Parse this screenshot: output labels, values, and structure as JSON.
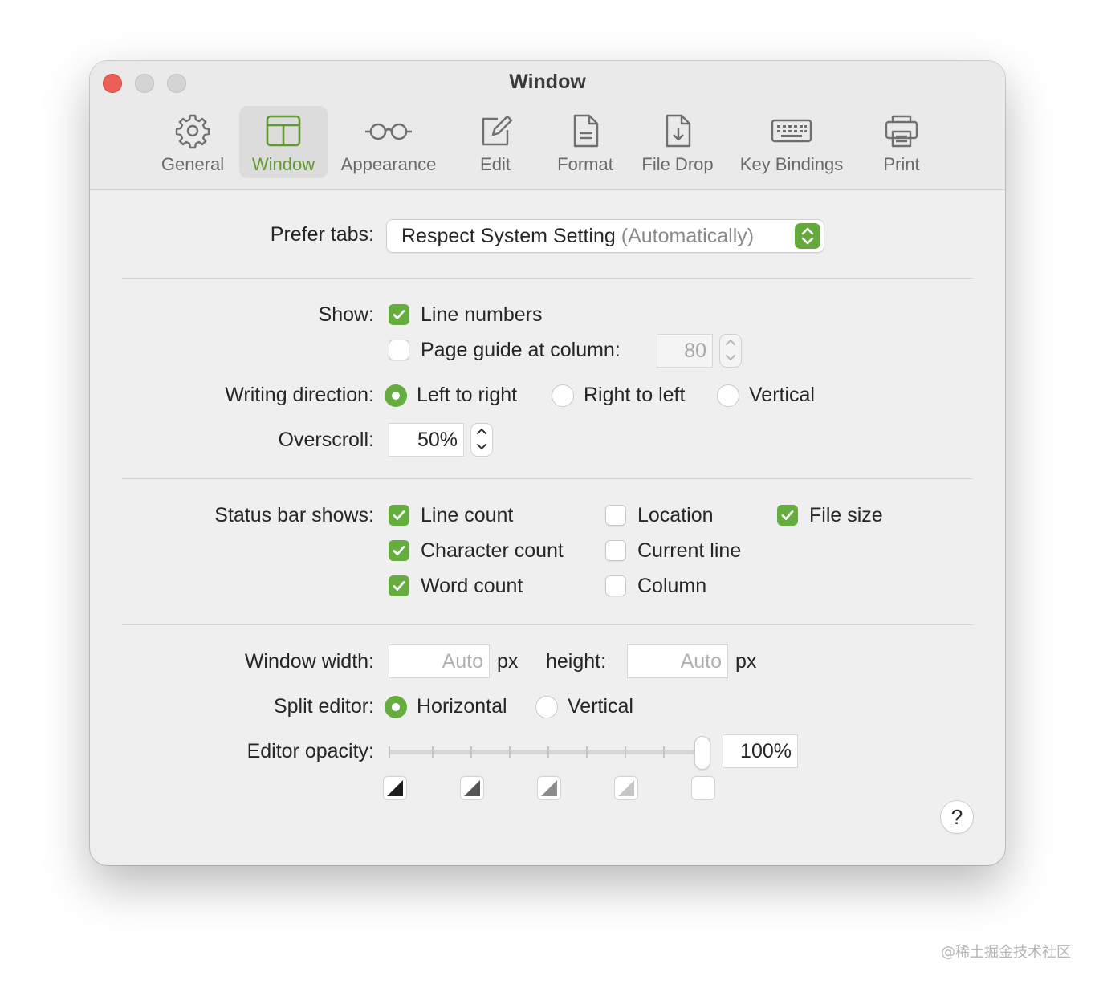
{
  "window": {
    "title": "Window"
  },
  "toolbar": {
    "tabs": [
      {
        "label": "General",
        "icon": "gear-icon"
      },
      {
        "label": "Window",
        "icon": "window-icon",
        "selected": true
      },
      {
        "label": "Appearance",
        "icon": "glasses-icon"
      },
      {
        "label": "Edit",
        "icon": "pencil-square-icon"
      },
      {
        "label": "Format",
        "icon": "document-icon"
      },
      {
        "label": "File Drop",
        "icon": "document-download-icon"
      },
      {
        "label": "Key Bindings",
        "icon": "keyboard-icon"
      },
      {
        "label": "Print",
        "icon": "printer-icon"
      }
    ]
  },
  "prefer_tabs": {
    "label": "Prefer tabs:",
    "value": "Respect System Setting",
    "value_secondary": "(Automatically)"
  },
  "show": {
    "label": "Show:",
    "line_numbers": {
      "label": "Line numbers",
      "checked": true
    },
    "page_guide": {
      "label": "Page guide at column:",
      "checked": false,
      "column": "80"
    }
  },
  "writing_direction": {
    "label": "Writing direction:",
    "options": [
      "Left to right",
      "Right to left",
      "Vertical"
    ],
    "selected": "Left to right"
  },
  "overscroll": {
    "label": "Overscroll:",
    "value": "50%"
  },
  "status_bar": {
    "label": "Status bar shows:",
    "items": [
      {
        "label": "Line count",
        "checked": true
      },
      {
        "label": "Character count",
        "checked": true
      },
      {
        "label": "Word count",
        "checked": true
      },
      {
        "label": "Location",
        "checked": false
      },
      {
        "label": "Current line",
        "checked": false
      },
      {
        "label": "Column",
        "checked": false
      },
      {
        "label": "File size",
        "checked": true
      }
    ]
  },
  "window_size": {
    "width_label": "Window width:",
    "width_placeholder": "Auto",
    "height_label": "height:",
    "height_placeholder": "Auto",
    "unit": "px"
  },
  "split_editor": {
    "label": "Split editor:",
    "options": [
      "Horizontal",
      "Vertical"
    ],
    "selected": "Horizontal"
  },
  "editor_opacity": {
    "label": "Editor opacity:",
    "value": "100%",
    "level": 1.0
  },
  "help": {
    "label": "?"
  },
  "watermark": "@稀土掘金技术社区",
  "colors": {
    "accent": "#65ad3e",
    "close": "#ec5f57"
  }
}
